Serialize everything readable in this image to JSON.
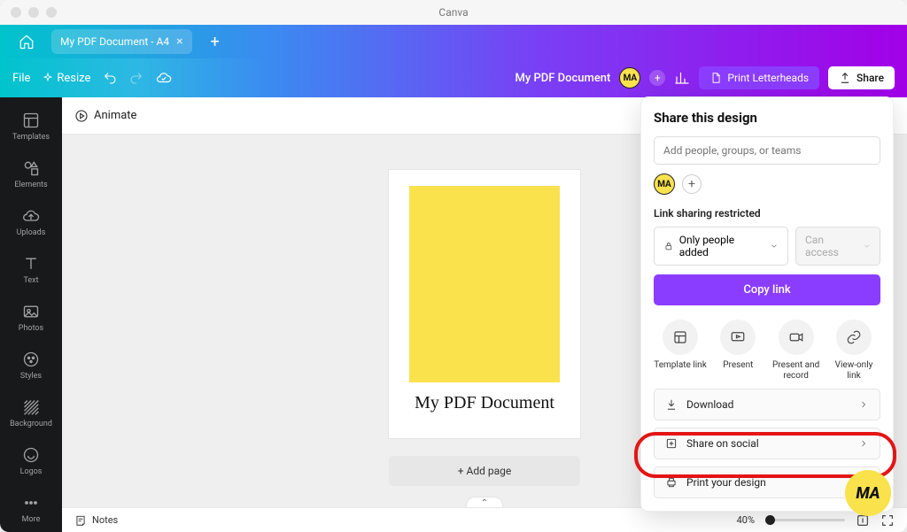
{
  "app_title": "Canva",
  "tabs": [
    {
      "label": "My PDF Document - A4"
    }
  ],
  "menu": {
    "file": "File",
    "resize": "Resize"
  },
  "header": {
    "doc_name": "My PDF Document",
    "avatar": "MA",
    "print": "Print Letterheads",
    "share": "Share"
  },
  "sidebar": {
    "items": [
      {
        "label": "Templates"
      },
      {
        "label": "Elements"
      },
      {
        "label": "Uploads"
      },
      {
        "label": "Text"
      },
      {
        "label": "Photos"
      },
      {
        "label": "Styles"
      },
      {
        "label": "Background"
      },
      {
        "label": "Logos"
      },
      {
        "label": "More"
      }
    ]
  },
  "toolbar": {
    "animate": "Animate"
  },
  "canvas": {
    "page_text": "My PDF Document",
    "add_page": "+ Add page"
  },
  "footer": {
    "notes": "Notes",
    "zoom": "40%"
  },
  "share_panel": {
    "title": "Share this design",
    "input_placeholder": "Add people, groups, or teams",
    "avatar": "MA",
    "section_label": "Link sharing restricted",
    "select_value": "Only people added",
    "select_disabled": "Can access",
    "copy": "Copy link",
    "actions": [
      {
        "label": "Template link"
      },
      {
        "label": "Present"
      },
      {
        "label": "Present and record"
      },
      {
        "label": "View-only link"
      }
    ],
    "list": [
      {
        "label": "Download"
      },
      {
        "label": "Share on social"
      },
      {
        "label": "Print your design"
      }
    ]
  },
  "badge": "MA"
}
